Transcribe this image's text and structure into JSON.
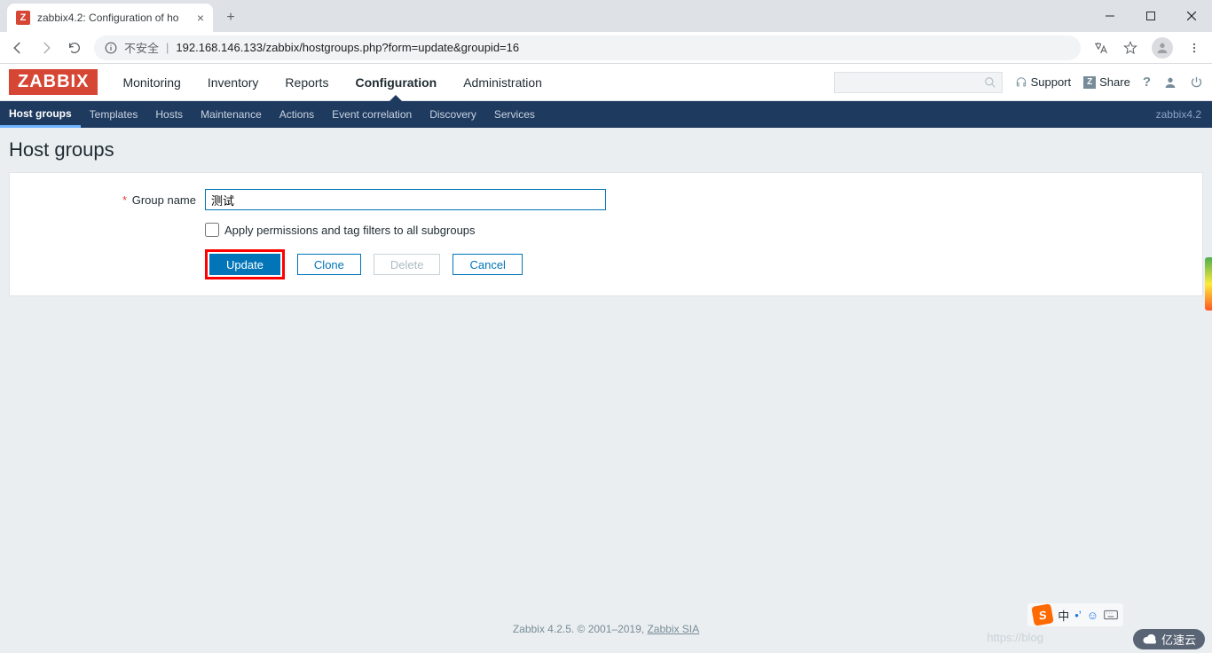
{
  "browser": {
    "tab_title": "zabbix4.2: Configuration of ho",
    "url_insecure_label": "不安全",
    "url": "192.168.146.133/zabbix/hostgroups.php?form=update&groupid=16"
  },
  "header": {
    "logo": "ZABBIX",
    "menu": [
      "Monitoring",
      "Inventory",
      "Reports",
      "Configuration",
      "Administration"
    ],
    "active_menu": "Configuration",
    "support": "Support",
    "share": "Share"
  },
  "subnav": {
    "items": [
      "Host groups",
      "Templates",
      "Hosts",
      "Maintenance",
      "Actions",
      "Event correlation",
      "Discovery",
      "Services"
    ],
    "active": "Host groups",
    "server_label": "zabbix4.2"
  },
  "page": {
    "title": "Host groups",
    "group_name_label": "Group name",
    "group_name_value": "测试",
    "apply_perm_label": "Apply permissions and tag filters to all subgroups",
    "btn_update": "Update",
    "btn_clone": "Clone",
    "btn_delete": "Delete",
    "btn_cancel": "Cancel"
  },
  "footer": {
    "text": "Zabbix 4.2.5. © 2001–2019, ",
    "link": "Zabbix SIA"
  },
  "watermark": {
    "blog": "https://blog",
    "brand": "亿速云",
    "ime_lang": "中"
  }
}
